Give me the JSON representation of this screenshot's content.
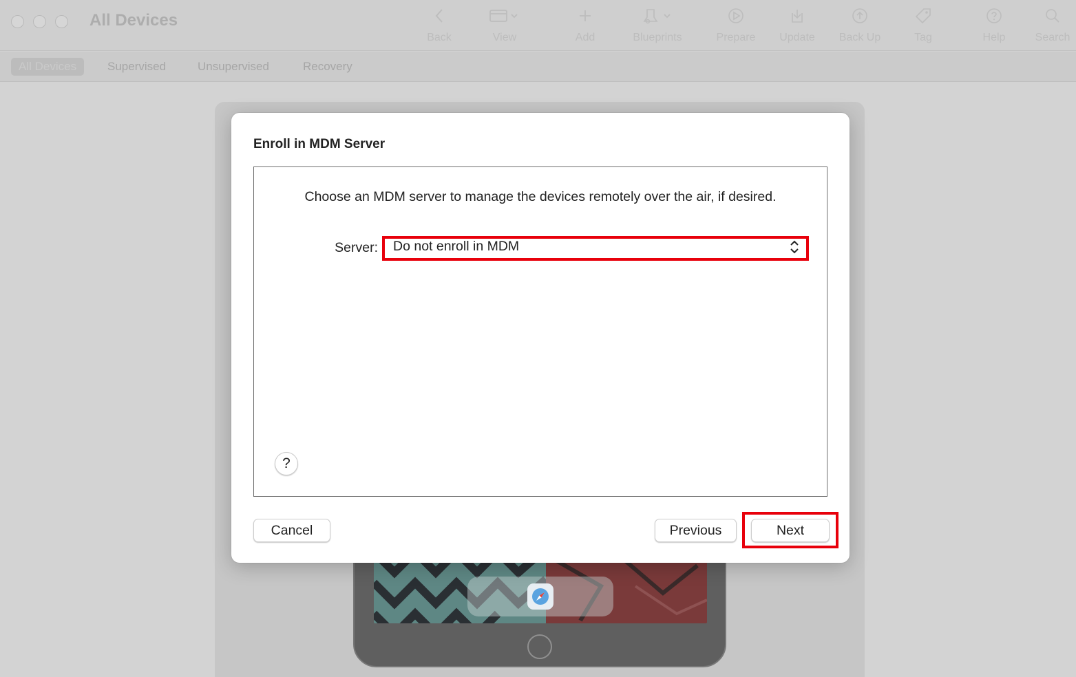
{
  "window": {
    "title": "All Devices",
    "traffic_lights": [
      "close",
      "minimize",
      "zoom"
    ]
  },
  "toolbar": {
    "items": [
      {
        "label": "Back",
        "icon": "chevron-left-icon"
      },
      {
        "label": "View",
        "icon": "window-icon"
      },
      {
        "label": "Add",
        "icon": "plus-icon"
      },
      {
        "label": "Blueprints",
        "icon": "blueprints-icon"
      },
      {
        "label": "Prepare",
        "icon": "prepare-icon"
      },
      {
        "label": "Update",
        "icon": "update-icon"
      },
      {
        "label": "Back Up",
        "icon": "backup-icon"
      },
      {
        "label": "Tag",
        "icon": "tag-icon"
      },
      {
        "label": "Help",
        "icon": "help-icon"
      },
      {
        "label": "Search",
        "icon": "search-icon"
      }
    ]
  },
  "filters": {
    "items": [
      {
        "label": "All Devices",
        "selected": true
      },
      {
        "label": "Supervised",
        "selected": false
      },
      {
        "label": "Unsupervised",
        "selected": false
      },
      {
        "label": "Recovery",
        "selected": false
      }
    ]
  },
  "dialog": {
    "title": "Enroll in MDM Server",
    "instructions": "Choose an MDM server to manage the devices remotely over the air, if desired.",
    "server_label": "Server:",
    "server_value": "Do not enroll in MDM",
    "help_label": "?",
    "cancel_label": "Cancel",
    "previous_label": "Previous",
    "next_label": "Next"
  },
  "colors": {
    "highlight": "#e8000b",
    "background": "#d3d3d3",
    "dialog": "#ffffff"
  }
}
